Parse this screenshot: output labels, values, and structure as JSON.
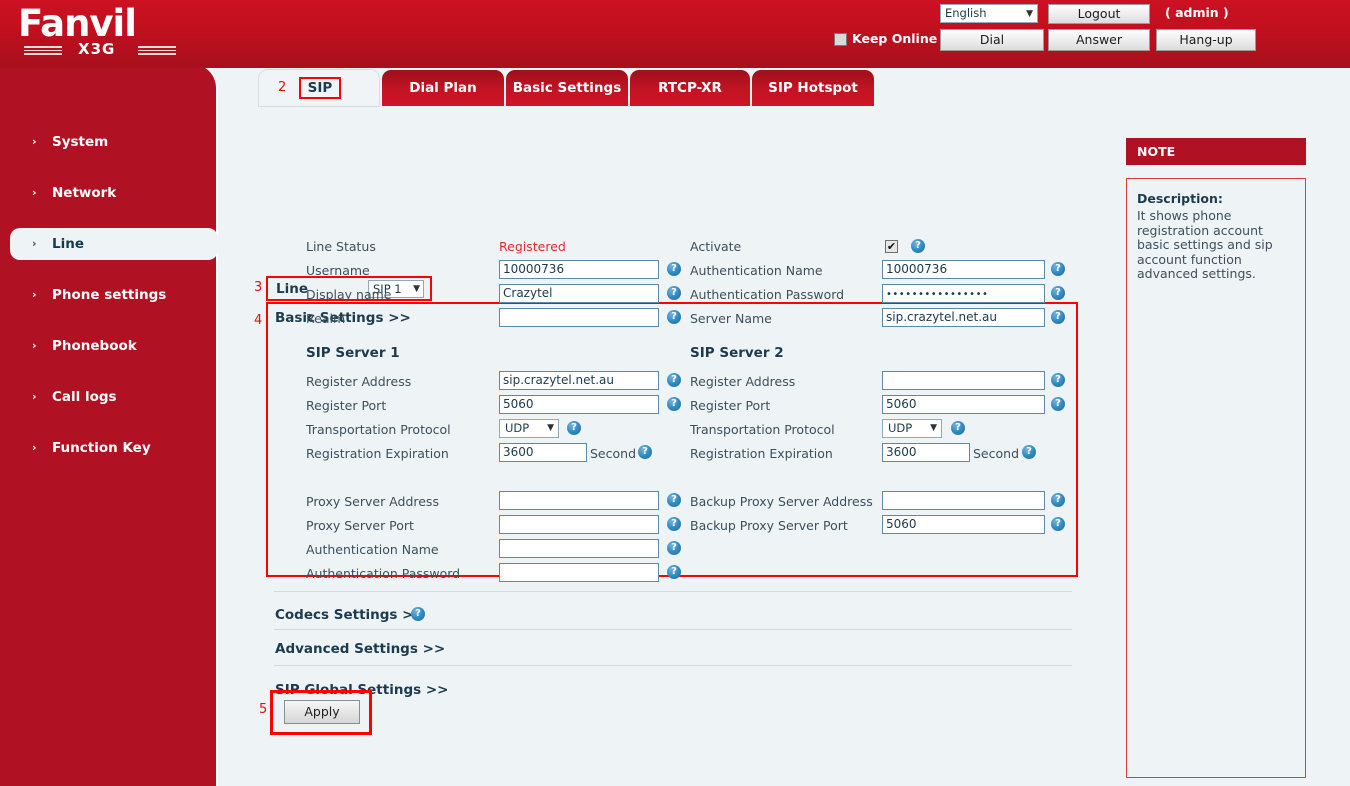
{
  "brand": {
    "name": "Fanvil",
    "model": "X3G"
  },
  "header": {
    "language": {
      "value": "English",
      "caret": "▼"
    },
    "logout_label": "Logout",
    "admin_label": "( admin )",
    "keep_online_label": "Keep Online",
    "dial_label": "Dial",
    "answer_label": "Answer",
    "hangup_label": "Hang-up"
  },
  "sidebar": {
    "items": [
      {
        "label": "System",
        "chevron": "›"
      },
      {
        "label": "Network",
        "chevron": "›"
      },
      {
        "label": "Line",
        "chevron": "›"
      },
      {
        "label": "Phone settings",
        "chevron": "›"
      },
      {
        "label": "Phonebook",
        "chevron": "›"
      },
      {
        "label": "Call logs",
        "chevron": "›"
      },
      {
        "label": "Function Key",
        "chevron": "›"
      }
    ],
    "active_marker": "2"
  },
  "tabs": {
    "marker": "2",
    "items": [
      {
        "label": "SIP"
      },
      {
        "label": "Dial Plan"
      },
      {
        "label": "Basic Settings"
      },
      {
        "label": "RTCP-XR"
      },
      {
        "label": "SIP Hotspot"
      }
    ]
  },
  "line_selector": {
    "marker": "3",
    "label": "Line",
    "value": "SIP 1",
    "caret": "▼"
  },
  "basic_settings": {
    "marker": "4",
    "title": "Basic Settings >>",
    "left": {
      "line_status_label": "Line Status",
      "line_status_value": "Registered",
      "username_label": "Username",
      "username_value": "10000736",
      "display_name_label": "Display name",
      "display_name_value": "Crazytel",
      "realm_label": "Realm",
      "realm_value": "",
      "server_title": "SIP Server 1",
      "register_address_label": "Register Address",
      "register_address_value": "sip.crazytel.net.au",
      "register_port_label": "Register Port",
      "register_port_value": "5060",
      "transport_label": "Transportation Protocol",
      "transport_value": "UDP",
      "expiration_label": "Registration Expiration",
      "expiration_value": "3600",
      "expiration_unit": "Second"
    },
    "right": {
      "activate_label": "Activate",
      "activate_checked": "✔",
      "auth_name_label": "Authentication Name",
      "auth_name_value": "10000736",
      "auth_pass_label": "Authentication Password",
      "auth_pass_value": "••••••••••••••••",
      "server_name_label": "Server Name",
      "server_name_value": "sip.crazytel.net.au",
      "server_title": "SIP Server 2",
      "register_address_label": "Register Address",
      "register_address_value": "",
      "register_port_label": "Register Port",
      "register_port_value": "5060",
      "transport_label": "Transportation Protocol",
      "transport_value": "UDP",
      "expiration_label": "Registration Expiration",
      "expiration_value": "3600",
      "expiration_unit": "Second"
    }
  },
  "proxy": {
    "left": [
      {
        "label": "Proxy Server Address",
        "value": ""
      },
      {
        "label": "Proxy Server Port",
        "value": ""
      },
      {
        "label": "Authentication Name",
        "value": ""
      },
      {
        "label": "Authentication Password",
        "value": ""
      }
    ],
    "right": [
      {
        "label": "Backup Proxy Server Address",
        "value": ""
      },
      {
        "label": "Backup Proxy Server Port",
        "value": "5060"
      }
    ]
  },
  "collapsed_sections": [
    {
      "label": "Codecs Settings >>",
      "has_help": true
    },
    {
      "label": "Advanced Settings >>",
      "has_help": false
    },
    {
      "label": "SIP Global Settings >>",
      "has_help": false
    }
  ],
  "apply": {
    "marker": "5",
    "label": "Apply"
  },
  "note": {
    "header": "NOTE",
    "title": "Description:",
    "description": "It shows phone registration account basic settings and sip account function advanced settings."
  },
  "icons": {
    "help": "?",
    "caret_down": "▼",
    "chevron_right": "›"
  },
  "colors": {
    "brand_red": "#b01223",
    "header_red": "#c4101f",
    "annotation_red": "#ff0000",
    "content_bg": "#eef3f5",
    "label_text": "#3d4f5c",
    "status_registered": "#e8282f"
  }
}
